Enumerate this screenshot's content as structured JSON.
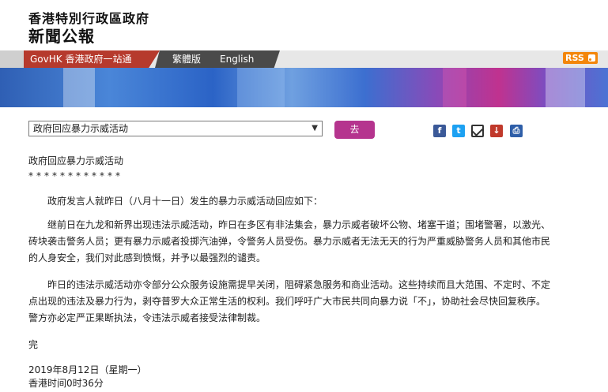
{
  "header": {
    "gov_name": "香港特別行政區政府",
    "press_title": "新聞公報"
  },
  "nav": {
    "govhk": "GovHK 香港政府一站通",
    "traditional": "繁體版",
    "english": "English",
    "rss": "RSS"
  },
  "colors": {
    "govhk_red": "#b63a2d",
    "nav_dark": "#4a4a4a",
    "go_magenta": "#b5348e",
    "rss_orange": "#f3860b"
  },
  "toolbar": {
    "topic_selected": "政府回应暴力示威活动",
    "go_label": "去",
    "share_icons": [
      "facebook-icon",
      "twitter-icon",
      "email-icon",
      "download-icon",
      "print-icon"
    ]
  },
  "article": {
    "title": "政府回应暴力示威活动",
    "stars": "************",
    "p1": "政府发言人就昨日（八月十一日）发生的暴力示威活动回应如下：",
    "p2": "继前日在九龙和新界出现违法示威活动，昨日在多区有非法集会，暴力示威者破坏公物、堵塞干道；围堵警署，以激光、砖块袭击警务人员；更有暴力示威者投掷汽油弹，令警务人员受伤。暴力示威者无法无天的行为严重威胁警务人员和其他市民的人身安全，我们对此感到愤慨，并予以最强烈的谴责。",
    "p3": "昨日的违法示威活动亦令部分公众服务设施需提早关闭，阻碍紧急服务和商业活动。这些持续而且大范围、不定时、不定点出现的违法及暴力行为，剥夺普罗大众正常生活的权利。我们呼吁广大市民共同向暴力说「不」，协助社会尽快回复秩序。警方亦必定严正果断执法，令违法示威者接受法律制裁。",
    "end": "完",
    "date": "2019年8月12日（星期一）",
    "time": "香港时间0时36分"
  }
}
